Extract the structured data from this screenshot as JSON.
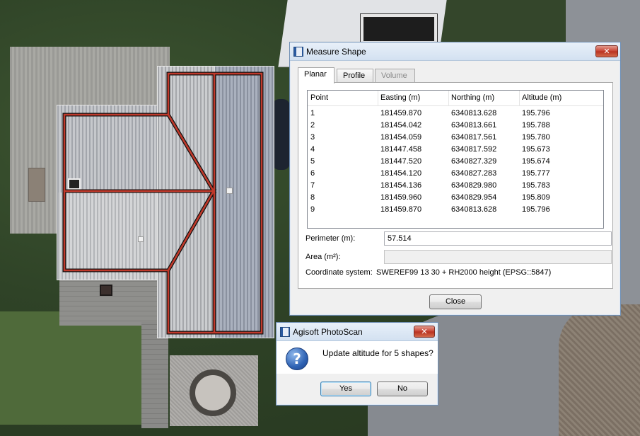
{
  "measure_dialog": {
    "title": "Measure Shape",
    "close_glyph": "✕",
    "tabs": [
      {
        "label": "Planar",
        "state": "active"
      },
      {
        "label": "Profile",
        "state": "normal"
      },
      {
        "label": "Volume",
        "state": "disabled"
      }
    ],
    "table": {
      "headers": [
        "Point",
        "Easting (m)",
        "Northing (m)",
        "Altitude (m)"
      ],
      "rows": [
        [
          "1",
          "181459.870",
          "6340813.628",
          "195.796"
        ],
        [
          "2",
          "181454.042",
          "6340813.661",
          "195.788"
        ],
        [
          "3",
          "181454.059",
          "6340817.561",
          "195.780"
        ],
        [
          "4",
          "181447.458",
          "6340817.592",
          "195.673"
        ],
        [
          "5",
          "181447.520",
          "6340827.329",
          "195.674"
        ],
        [
          "6",
          "181454.120",
          "6340827.283",
          "195.777"
        ],
        [
          "7",
          "181454.136",
          "6340829.980",
          "195.783"
        ],
        [
          "8",
          "181459.960",
          "6340829.954",
          "195.809"
        ],
        [
          "9",
          "181459.870",
          "6340813.628",
          "195.796"
        ]
      ]
    },
    "perimeter_label": "Perimeter (m):",
    "perimeter_value": "57.514",
    "area_label": "Area (m²):",
    "area_value": "",
    "coord_label": "Coordinate system:",
    "coord_value": "SWEREF99 13 30 + RH2000 height (EPSG::5847)",
    "close_label": "Close"
  },
  "prompt_dialog": {
    "title": "Agisoft PhotoScan",
    "close_glyph": "✕",
    "icon": "question-icon",
    "icon_glyph": "?",
    "message": "Update altitude for 5 shapes?",
    "yes_label": "Yes",
    "no_label": "No"
  },
  "colors": {
    "shape_outline": "#c0392b",
    "title_gradient_top": "#e8f0f9",
    "close_button": "#c64030"
  }
}
